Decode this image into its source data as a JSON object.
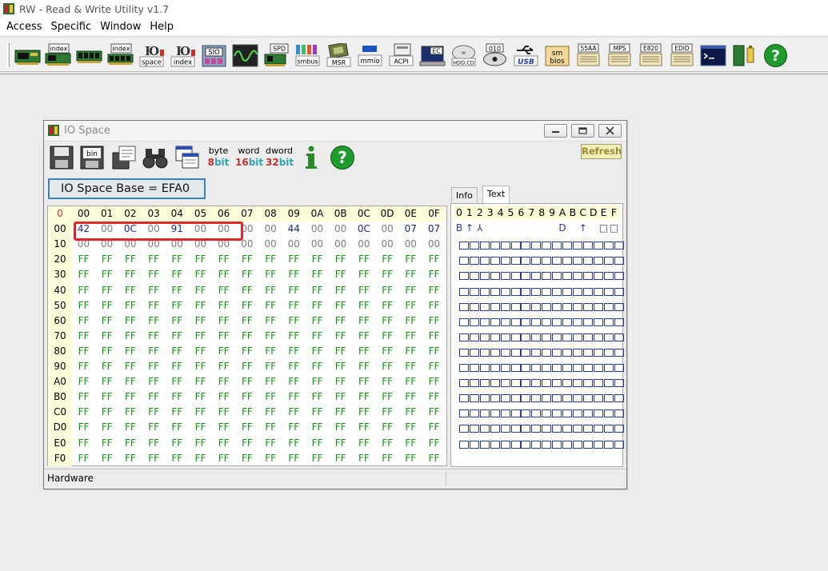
{
  "app": {
    "title": "RW - Read & Write Utility v1.7"
  },
  "menu": [
    "Access",
    "Specific",
    "Window",
    "Help"
  ],
  "toolbar": {
    "icons": [
      "pci-icon",
      "pci-index-icon",
      "memory-icon",
      "memory-index-icon",
      "io-space-icon",
      "io-index-icon",
      "sio-icon",
      "oscilloscope-icon",
      "spd-icon",
      "smbus-icon",
      "msr-icon",
      "mmio-icon",
      "acpi-icon",
      "ec-icon",
      "hdd-icon",
      "cmos-icon",
      "usb-icon",
      "smbios-icon",
      "55aa-icon",
      "mps-icon",
      "e820-icon",
      "edid-icon",
      "command-icon",
      "battery-icon",
      "help-icon"
    ],
    "labels": {
      "pci_index": "index",
      "mem_index": "index",
      "space": "space",
      "io_index": "index",
      "sio": "SIO",
      "spd": "SPD",
      "smbus": "smbus",
      "msr": "MSR",
      "mmio": "mmio",
      "acpi": "ACPI",
      "ec": "EC",
      "hdd": "HDD,CD",
      "cmos": "010",
      "usb": "USB",
      "smbios_top": "sm",
      "smbios_bot": "bios",
      "aa55": "55AA",
      "mps": "MPS",
      "e820": "E820",
      "edid": "EDID"
    }
  },
  "io_window": {
    "title": "IO Space",
    "refresh": "Refresh",
    "base_label": "IO Space Base = EFA0",
    "bits": [
      {
        "top": "byte",
        "num": "8",
        "bit": "bit"
      },
      {
        "top": "word",
        "num": "16",
        "bit": "bit"
      },
      {
        "top": "dword",
        "num": "32",
        "bit": "bit"
      }
    ],
    "toolbar_labels": {
      "bin": "bin"
    },
    "corner": "0",
    "col_headers": [
      "00",
      "01",
      "02",
      "03",
      "04",
      "05",
      "06",
      "07",
      "08",
      "09",
      "0A",
      "0B",
      "0C",
      "0D",
      "0E",
      "0F"
    ],
    "row_headers": [
      "00",
      "10",
      "20",
      "30",
      "40",
      "50",
      "60",
      "70",
      "80",
      "90",
      "A0",
      "B0",
      "C0",
      "D0",
      "E0",
      "F0"
    ],
    "rows": [
      [
        "42",
        "00",
        "0C",
        "00",
        "91",
        "00",
        "00",
        "00",
        "00",
        "44",
        "00",
        "00",
        "0C",
        "00",
        "07",
        "07"
      ],
      [
        "00",
        "00",
        "00",
        "00",
        "00",
        "00",
        "00",
        "00",
        "00",
        "00",
        "00",
        "00",
        "00",
        "00",
        "00",
        "00"
      ],
      [
        "FF",
        "FF",
        "FF",
        "FF",
        "FF",
        "FF",
        "FF",
        "FF",
        "FF",
        "FF",
        "FF",
        "FF",
        "FF",
        "FF",
        "FF",
        "FF"
      ],
      [
        "FF",
        "FF",
        "FF",
        "FF",
        "FF",
        "FF",
        "FF",
        "FF",
        "FF",
        "FF",
        "FF",
        "FF",
        "FF",
        "FF",
        "FF",
        "FF"
      ],
      [
        "FF",
        "FF",
        "FF",
        "FF",
        "FF",
        "FF",
        "FF",
        "FF",
        "FF",
        "FF",
        "FF",
        "FF",
        "FF",
        "FF",
        "FF",
        "FF"
      ],
      [
        "FF",
        "FF",
        "FF",
        "FF",
        "FF",
        "FF",
        "FF",
        "FF",
        "FF",
        "FF",
        "FF",
        "FF",
        "FF",
        "FF",
        "FF",
        "FF"
      ],
      [
        "FF",
        "FF",
        "FF",
        "FF",
        "FF",
        "FF",
        "FF",
        "FF",
        "FF",
        "FF",
        "FF",
        "FF",
        "FF",
        "FF",
        "FF",
        "FF"
      ],
      [
        "FF",
        "FF",
        "FF",
        "FF",
        "FF",
        "FF",
        "FF",
        "FF",
        "FF",
        "FF",
        "FF",
        "FF",
        "FF",
        "FF",
        "FF",
        "FF"
      ],
      [
        "FF",
        "FF",
        "FF",
        "FF",
        "FF",
        "FF",
        "FF",
        "FF",
        "FF",
        "FF",
        "FF",
        "FF",
        "FF",
        "FF",
        "FF",
        "FF"
      ],
      [
        "FF",
        "FF",
        "FF",
        "FF",
        "FF",
        "FF",
        "FF",
        "FF",
        "FF",
        "FF",
        "FF",
        "FF",
        "FF",
        "FF",
        "FF",
        "FF"
      ],
      [
        "FF",
        "FF",
        "FF",
        "FF",
        "FF",
        "FF",
        "FF",
        "FF",
        "FF",
        "FF",
        "FF",
        "FF",
        "FF",
        "FF",
        "FF",
        "FF"
      ],
      [
        "FF",
        "FF",
        "FF",
        "FF",
        "FF",
        "FF",
        "FF",
        "FF",
        "FF",
        "FF",
        "FF",
        "FF",
        "FF",
        "FF",
        "FF",
        "FF"
      ],
      [
        "FF",
        "FF",
        "FF",
        "FF",
        "FF",
        "FF",
        "FF",
        "FF",
        "FF",
        "FF",
        "FF",
        "FF",
        "FF",
        "FF",
        "FF",
        "FF"
      ],
      [
        "FF",
        "FF",
        "FF",
        "FF",
        "FF",
        "FF",
        "FF",
        "FF",
        "FF",
        "FF",
        "FF",
        "FF",
        "FF",
        "FF",
        "FF",
        "FF"
      ],
      [
        "FF",
        "FF",
        "FF",
        "FF",
        "FF",
        "FF",
        "FF",
        "FF",
        "FF",
        "FF",
        "FF",
        "FF",
        "FF",
        "FF",
        "FF",
        "FF"
      ],
      [
        "FF",
        "FF",
        "FF",
        "FF",
        "FF",
        "FF",
        "FF",
        "FF",
        "FF",
        "FF",
        "FF",
        "FF",
        "FF",
        "FF",
        "FF",
        "FF"
      ]
    ],
    "highlight": {
      "row": "00",
      "from_col": "00",
      "to_col": "06"
    },
    "tabs": [
      {
        "label": "Info",
        "active": false
      },
      {
        "label": "Text",
        "active": true
      }
    ],
    "text_header": [
      "0",
      "1",
      "2",
      "3",
      "4",
      "5",
      "6",
      "7",
      "8",
      "9",
      "A",
      "B",
      "C",
      "D",
      "E",
      "F"
    ],
    "text_row0": [
      "B",
      "↑",
      "⅄",
      "",
      "",
      "",
      "",
      "",
      "",
      "",
      "D",
      "",
      "↑",
      "",
      "□",
      "□"
    ],
    "status": "Hardware"
  },
  "colors": {
    "value_blue": "#1a2b8c",
    "value_gray": "#7d7d7d",
    "value_green": "#149614",
    "header_bg": "#fffedb",
    "highlight_red": "#e1262b",
    "base_border": "#3b82c4"
  }
}
